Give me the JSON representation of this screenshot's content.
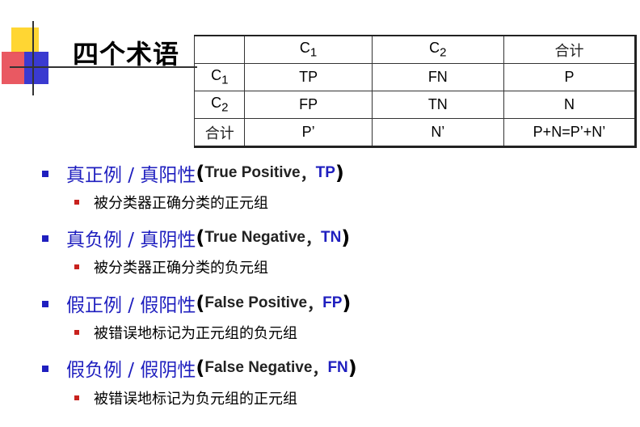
{
  "title": "四个术语",
  "table": {
    "header": [
      "",
      "C1",
      "C2",
      "合计"
    ],
    "rows": [
      [
        "C1",
        "TP",
        "FN",
        "P"
      ],
      [
        "C2",
        "FP",
        "TN",
        "N"
      ],
      [
        "合计",
        "P’",
        "N’",
        "P+N=P’+N’"
      ]
    ]
  },
  "terms": [
    {
      "cn": "真正例 / 真阳性",
      "en": "True Positive",
      "abbr": "TP",
      "desc": "被分类器正确分类的正元组"
    },
    {
      "cn": "真负例 / 真阴性",
      "en": "True Negative",
      "abbr": "TN",
      "desc": "被分类器正确分类的负元组"
    },
    {
      "cn": "假正例 / 假阳性",
      "en": "False Positive",
      "abbr": "FP",
      "desc": "被错误地标记为正元组的负元组"
    },
    {
      "cn": "假负例 / 假阴性",
      "en": "False Negative",
      "abbr": "FN",
      "desc": "被错误地标记为负元组的正元组"
    }
  ],
  "punct": {
    "open": "(",
    "comma": "，",
    "close": ")"
  },
  "colors": {
    "accent_blue": "#1f1fbf",
    "bullet_red": "#c8221e",
    "deco_yellow": "#ffd633",
    "deco_red": "#e8505a",
    "deco_blue": "#3a3ad0"
  }
}
